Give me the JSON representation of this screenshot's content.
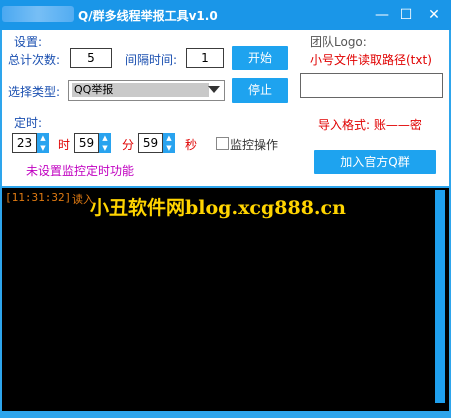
{
  "window": {
    "title": "Q/群多线程举报工具v1.0",
    "minimize_glyph": "—",
    "maximize_glyph": "☐",
    "close_glyph": "✕"
  },
  "settings": {
    "section_label": "设置:",
    "total_count_label": "总计次数:",
    "total_count_value": "5",
    "interval_label": "间隔时间:",
    "interval_value": "1",
    "start_button": "开始",
    "type_label": "选择类型:",
    "type_value": "QQ举报",
    "stop_button": "停止"
  },
  "timer": {
    "section_label": "定时:",
    "hour_value": "23",
    "hour_unit": "时",
    "minute_value": "59",
    "minute_unit": "分",
    "second_value": "59",
    "second_unit": "秒",
    "monitor_label": "监控操作",
    "status_text": "未设置监控定时功能"
  },
  "logo": {
    "label": "团队Logo:",
    "path_hint": "小号文件读取路径(txt)",
    "path_value": "",
    "import_format": "导入格式: 账——密",
    "join_group_button": "加入官方Q群"
  },
  "log": {
    "entries": [
      {
        "time": "[11:31:32]",
        "message": "读入"
      }
    ]
  },
  "watermark": "小丑软件网blog.xcg888.cn",
  "colors": {
    "accent": "#1ea3ef",
    "title_bar": "#1a96e8",
    "label_blue": "#1a4fb0",
    "error_red": "#e00000",
    "status_magenta": "#c000c0",
    "log_orange": "#e07a12",
    "watermark_yellow": "#ffd400"
  }
}
